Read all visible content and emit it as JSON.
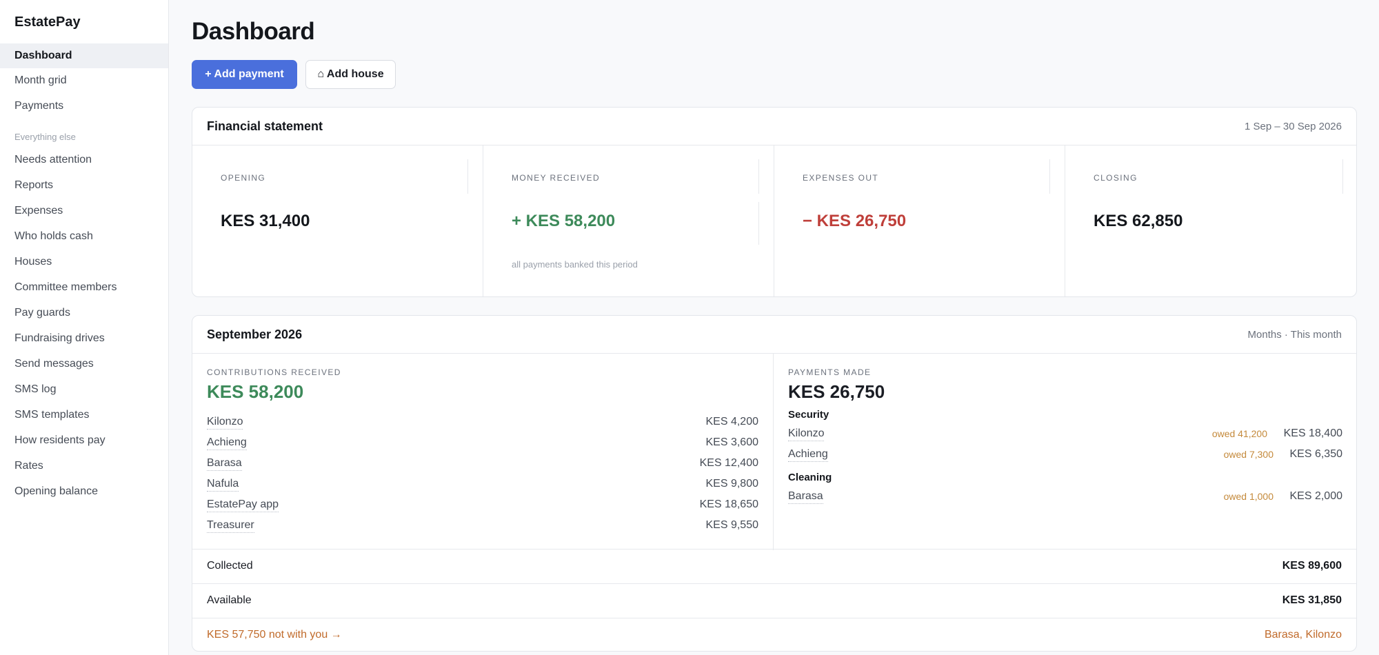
{
  "app": {
    "name": "EstatePay"
  },
  "sidebar": {
    "items": [
      {
        "label": "Dashboard"
      },
      {
        "label": "Month grid"
      },
      {
        "label": "Payments"
      }
    ],
    "section_label": "Everything else",
    "more_items": [
      {
        "label": "Needs attention"
      },
      {
        "label": "Reports"
      },
      {
        "label": "Expenses"
      },
      {
        "label": "Who holds cash"
      },
      {
        "label": "Houses"
      },
      {
        "label": "Committee members"
      },
      {
        "label": "Pay guards"
      },
      {
        "label": "Fundraising drives"
      },
      {
        "label": "Send messages"
      },
      {
        "label": "SMS log"
      },
      {
        "label": "SMS templates"
      },
      {
        "label": "How residents pay"
      },
      {
        "label": "Rates"
      },
      {
        "label": "Opening balance"
      }
    ]
  },
  "page": {
    "title": "Dashboard"
  },
  "actions": {
    "add_payment": "+ Add payment",
    "add_house": "⌂ Add house"
  },
  "statement": {
    "title": "Financial statement",
    "period": "1 Sep – 30 Sep 2026",
    "opening": {
      "label": "OPENING",
      "value": "KES 31,400"
    },
    "received": {
      "label": "MONEY RECEIVED",
      "value": "+ KES 58,200",
      "note": "all payments banked this period"
    },
    "expenses": {
      "label": "EXPENSES OUT",
      "value": "− KES 26,750"
    },
    "closing": {
      "label": "CLOSING",
      "value": "KES 62,850"
    }
  },
  "month": {
    "title": "September 2026",
    "meta": "Months · This month",
    "contributions": {
      "label": "CONTRIBUTIONS RECEIVED",
      "total": "KES 58,200",
      "rows": [
        {
          "name": "Kilonzo",
          "amount": "KES 4,200"
        },
        {
          "name": "Achieng",
          "amount": "KES 3,600"
        },
        {
          "name": "Barasa",
          "amount": "KES 12,400"
        },
        {
          "name": "Nafula",
          "amount": "KES 9,800"
        },
        {
          "name": "EstatePay app",
          "amount": "KES 18,650"
        },
        {
          "name": "Treasurer",
          "amount": "KES 9,550"
        }
      ]
    },
    "payments": {
      "label": "PAYMENTS MADE",
      "total": "KES 26,750",
      "groups": [
        {
          "title": "Security",
          "rows": [
            {
              "name": "Kilonzo",
              "owed": "owed 41,200",
              "amount": "KES 18,400"
            },
            {
              "name": "Achieng",
              "owed": "owed 7,300",
              "amount": "KES 6,350"
            }
          ]
        },
        {
          "title": "Cleaning",
          "rows": [
            {
              "name": "Barasa",
              "owed": "owed 1,000",
              "amount": "KES 2,000"
            }
          ]
        }
      ]
    },
    "collected": {
      "label": "Collected",
      "value": "KES 89,600"
    },
    "available": {
      "label": "Available",
      "value": "KES 31,850"
    },
    "not_with_you": {
      "label": "KES 57,750 not with you →",
      "holders": "Barasa, Kilonzo"
    }
  },
  "colors": {
    "accent": "#4a6fdc",
    "positive": "#3d8a5a",
    "negative": "#bf3f3a",
    "warning": "#c06a2a",
    "owed": "#c4893a"
  }
}
